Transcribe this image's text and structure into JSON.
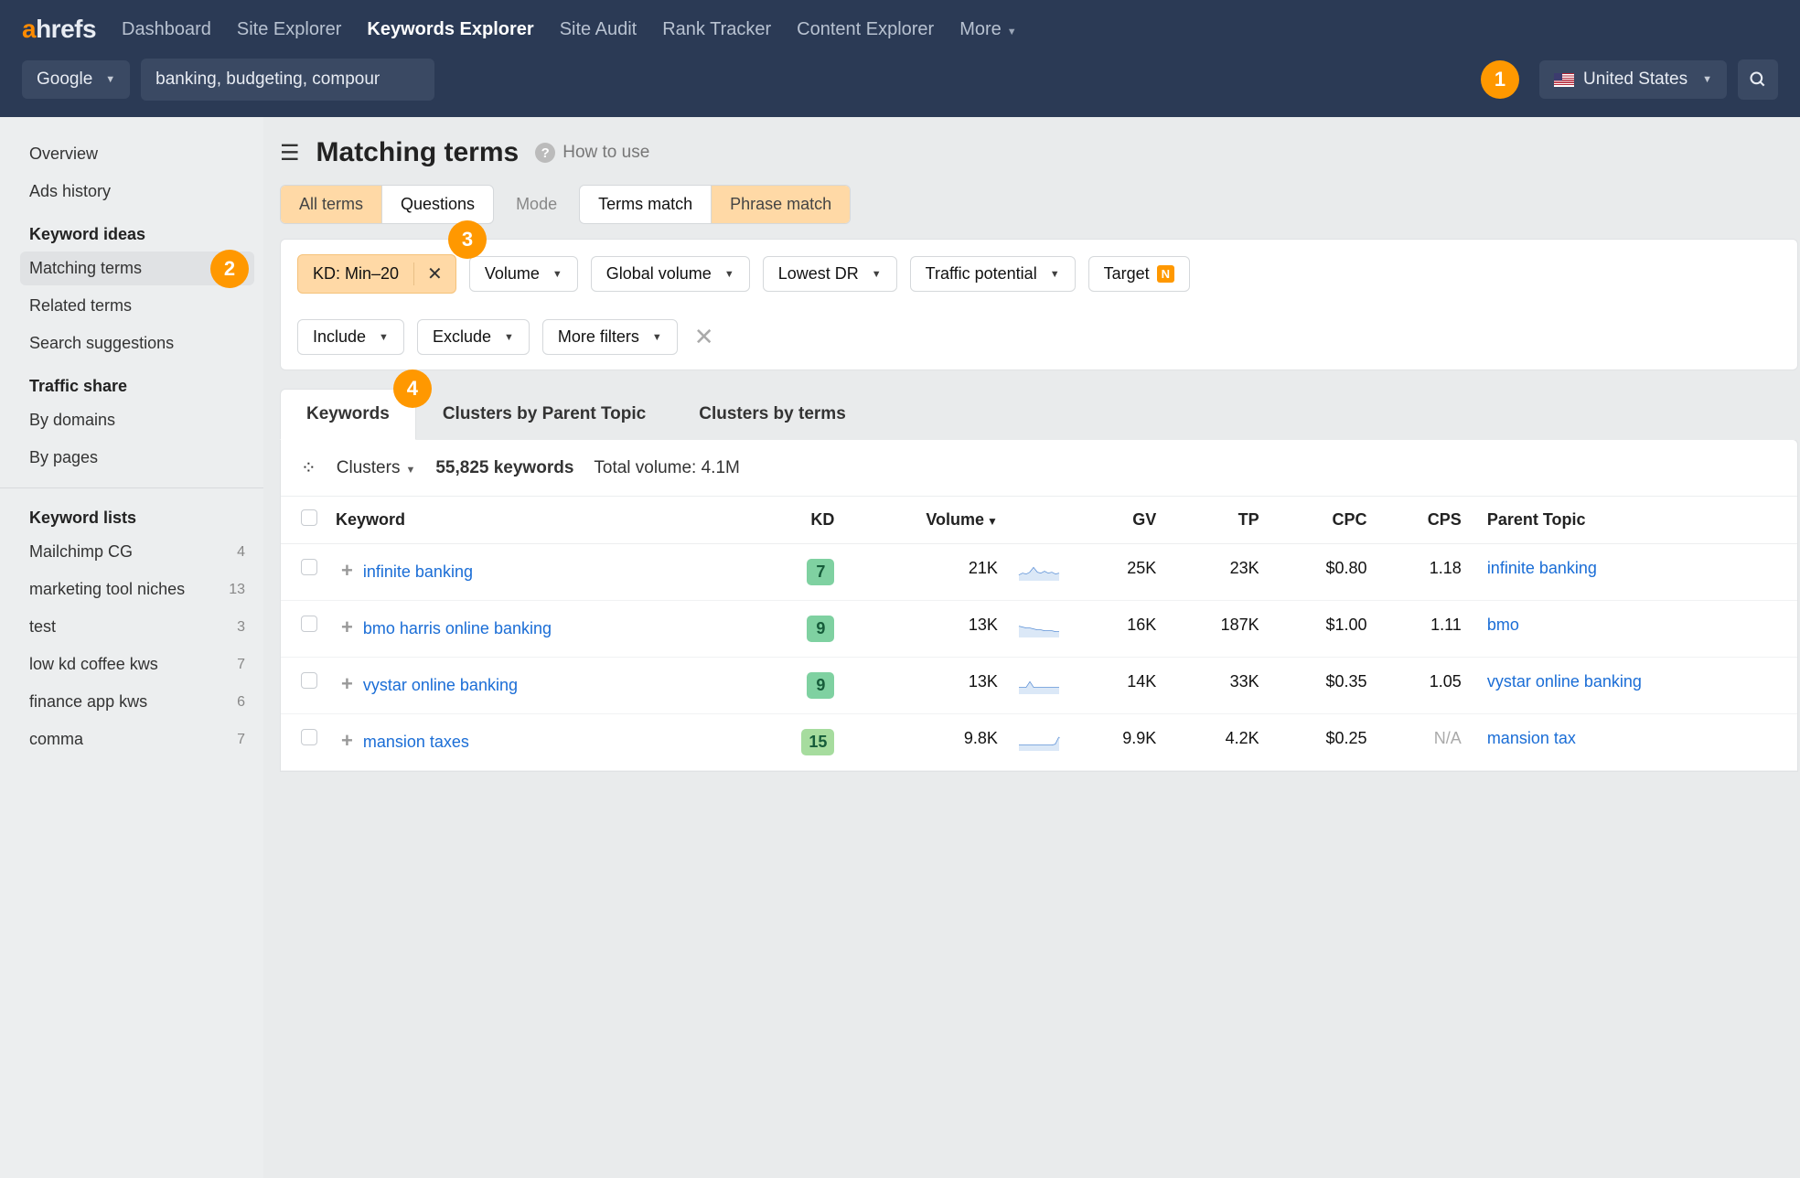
{
  "nav": {
    "logo_a": "a",
    "logo_rest": "hrefs",
    "items": [
      "Dashboard",
      "Site Explorer",
      "Keywords Explorer",
      "Site Audit",
      "Rank Tracker",
      "Content Explorer"
    ],
    "active_index": 2,
    "more": "More"
  },
  "search": {
    "engine": "Google",
    "query": "banking, budgeting, compound interest, credit score, early retirement, investing, taxes",
    "country": "United States"
  },
  "callouts": {
    "c1": "1",
    "c2": "2",
    "c3": "3",
    "c4": "4"
  },
  "sidebar": {
    "top": [
      "Overview",
      "Ads history"
    ],
    "ideas_title": "Keyword ideas",
    "ideas": [
      "Matching terms",
      "Related terms",
      "Search suggestions"
    ],
    "ideas_active": 0,
    "traffic_title": "Traffic share",
    "traffic": [
      "By domains",
      "By pages"
    ],
    "lists_title": "Keyword lists",
    "lists": [
      {
        "name": "Mailchimp CG",
        "count": 4
      },
      {
        "name": "marketing tool niches",
        "count": 13
      },
      {
        "name": "test",
        "count": 3
      },
      {
        "name": "low kd coffee kws",
        "count": 7
      },
      {
        "name": "finance app kws",
        "count": 6
      },
      {
        "name": "comma",
        "count": 7
      }
    ]
  },
  "page": {
    "title": "Matching terms",
    "howto": "How to use",
    "term_tabs": {
      "all": "All terms",
      "q": "Questions"
    },
    "mode_label": "Mode",
    "match_tabs": {
      "terms": "Terms match",
      "phrase": "Phrase match"
    }
  },
  "filters": {
    "kd": "KD: Min–20",
    "vol": "Volume",
    "gv": "Global volume",
    "dr": "Lowest DR",
    "tp": "Traffic potential",
    "target": "Target",
    "include": "Include",
    "exclude": "Exclude",
    "more": "More filters"
  },
  "result_tabs": {
    "kw": "Keywords",
    "parent": "Clusters by Parent Topic",
    "terms": "Clusters by terms"
  },
  "meta": {
    "clusters": "Clusters",
    "count": "55,825 keywords",
    "volume": "Total volume: 4.1M"
  },
  "columns": {
    "kw": "Keyword",
    "kd": "KD",
    "vol": "Volume",
    "gv": "GV",
    "tp": "TP",
    "cpc": "CPC",
    "cps": "CPS",
    "pt": "Parent Topic"
  },
  "rows": [
    {
      "kw": "infinite banking",
      "kd": 7,
      "vol": "21K",
      "gv": "25K",
      "tp": "23K",
      "cpc": "$0.80",
      "cps": "1.18",
      "pt": "infinite banking",
      "spark": [
        6,
        8,
        7,
        9,
        14,
        9,
        8,
        10,
        8,
        9,
        7,
        8
      ]
    },
    {
      "kw": "bmo harris online banking",
      "kd": 9,
      "vol": "13K",
      "gv": "16K",
      "tp": "187K",
      "cpc": "$1.00",
      "cps": "1.11",
      "pt": "bmo",
      "spark": [
        12,
        11,
        10,
        10,
        9,
        8,
        8,
        7,
        7,
        7,
        6,
        6
      ]
    },
    {
      "kw": "vystar online banking",
      "kd": 9,
      "vol": "13K",
      "gv": "14K",
      "tp": "33K",
      "cpc": "$0.35",
      "cps": "1.05",
      "pt": "vystar online banking",
      "spark": [
        7,
        7,
        7,
        13,
        7,
        7,
        7,
        7,
        7,
        7,
        7,
        7
      ]
    },
    {
      "kw": "mansion taxes",
      "kd": 15,
      "vol": "9.8K",
      "gv": "9.9K",
      "tp": "4.2K",
      "cpc": "$0.25",
      "cps": "N/A",
      "pt": "mansion tax",
      "spark": [
        6,
        6,
        6,
        6,
        6,
        6,
        6,
        6,
        6,
        6,
        7,
        15
      ]
    }
  ]
}
